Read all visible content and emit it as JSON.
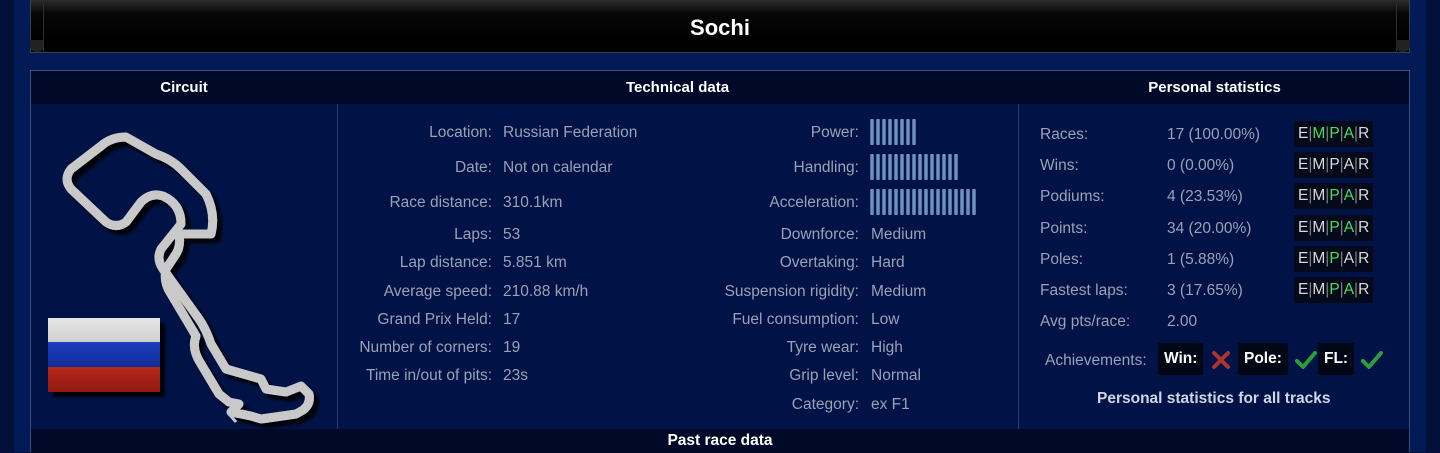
{
  "page": {
    "title": "Sochi"
  },
  "columns": {
    "circuit": "Circuit",
    "technical": "Technical data",
    "personal": "Personal statistics"
  },
  "flag": {
    "colors": [
      "#ffffff",
      "#1536b8",
      "#c8261c"
    ]
  },
  "technical": {
    "left": [
      {
        "label": "Location:",
        "value": "Russian Federation"
      },
      {
        "label": "Date:",
        "value": "Not on calendar"
      },
      {
        "label": "Race distance:",
        "value": "310.1km"
      },
      {
        "label": "Laps:",
        "value": "53"
      },
      {
        "label": "Lap distance:",
        "value": "5.851 km"
      },
      {
        "label": "Average speed:",
        "value": "210.88 km/h"
      },
      {
        "label": "Grand Prix Held:",
        "value": "17"
      },
      {
        "label": "Number of corners:",
        "value": "19"
      },
      {
        "label": "Time in/out of pits:",
        "value": "23s"
      }
    ],
    "bars": [
      {
        "label": "Power:",
        "segments": 8
      },
      {
        "label": "Handling:",
        "segments": 15
      },
      {
        "label": "Acceleration:",
        "segments": 18
      }
    ],
    "right": [
      {
        "label": "Downforce:",
        "value": "Medium"
      },
      {
        "label": "Overtaking:",
        "value": "Hard"
      },
      {
        "label": "Suspension rigidity:",
        "value": "Medium"
      },
      {
        "label": "Fuel consumption:",
        "value": "Low"
      },
      {
        "label": "Tyre wear:",
        "value": "High"
      },
      {
        "label": "Grip level:",
        "value": "Normal"
      },
      {
        "label": "Category:",
        "value": "ex F1"
      }
    ]
  },
  "personal": {
    "rows": [
      {
        "label": "Races:",
        "value": "17 (100.00%)",
        "empar": [
          false,
          true,
          true,
          true,
          false
        ]
      },
      {
        "label": "Wins:",
        "value": "0 (0.00%)",
        "empar": [
          false,
          false,
          false,
          false,
          false
        ]
      },
      {
        "label": "Podiums:",
        "value": "4 (23.53%)",
        "empar": [
          false,
          false,
          true,
          true,
          false
        ]
      },
      {
        "label": "Points:",
        "value": "34 (20.00%)",
        "empar": [
          false,
          false,
          true,
          true,
          false
        ]
      },
      {
        "label": "Poles:",
        "value": "1 (5.88%)",
        "empar": [
          false,
          false,
          true,
          false,
          false
        ]
      },
      {
        "label": "Fastest laps:",
        "value": "3 (17.65%)",
        "empar": [
          false,
          false,
          true,
          true,
          false
        ]
      }
    ],
    "empar_letters": [
      "E",
      "M",
      "P",
      "A",
      "R"
    ],
    "avg": {
      "label": "Avg pts/race:",
      "value": "2.00"
    },
    "achievements": {
      "label": "Achievements:",
      "win": "Win:",
      "pole": "Pole:",
      "fl": "FL:",
      "win_icon": "cross-icon",
      "pole_icon": "check-icon",
      "fl_icon": "check-icon"
    },
    "all_tracks_link": "Personal statistics for all tracks"
  },
  "footer": {
    "title": "Past race data"
  },
  "colors": {
    "active": "#45e05c",
    "label": "#9aa1b4",
    "bar": "#7fa1cf"
  }
}
